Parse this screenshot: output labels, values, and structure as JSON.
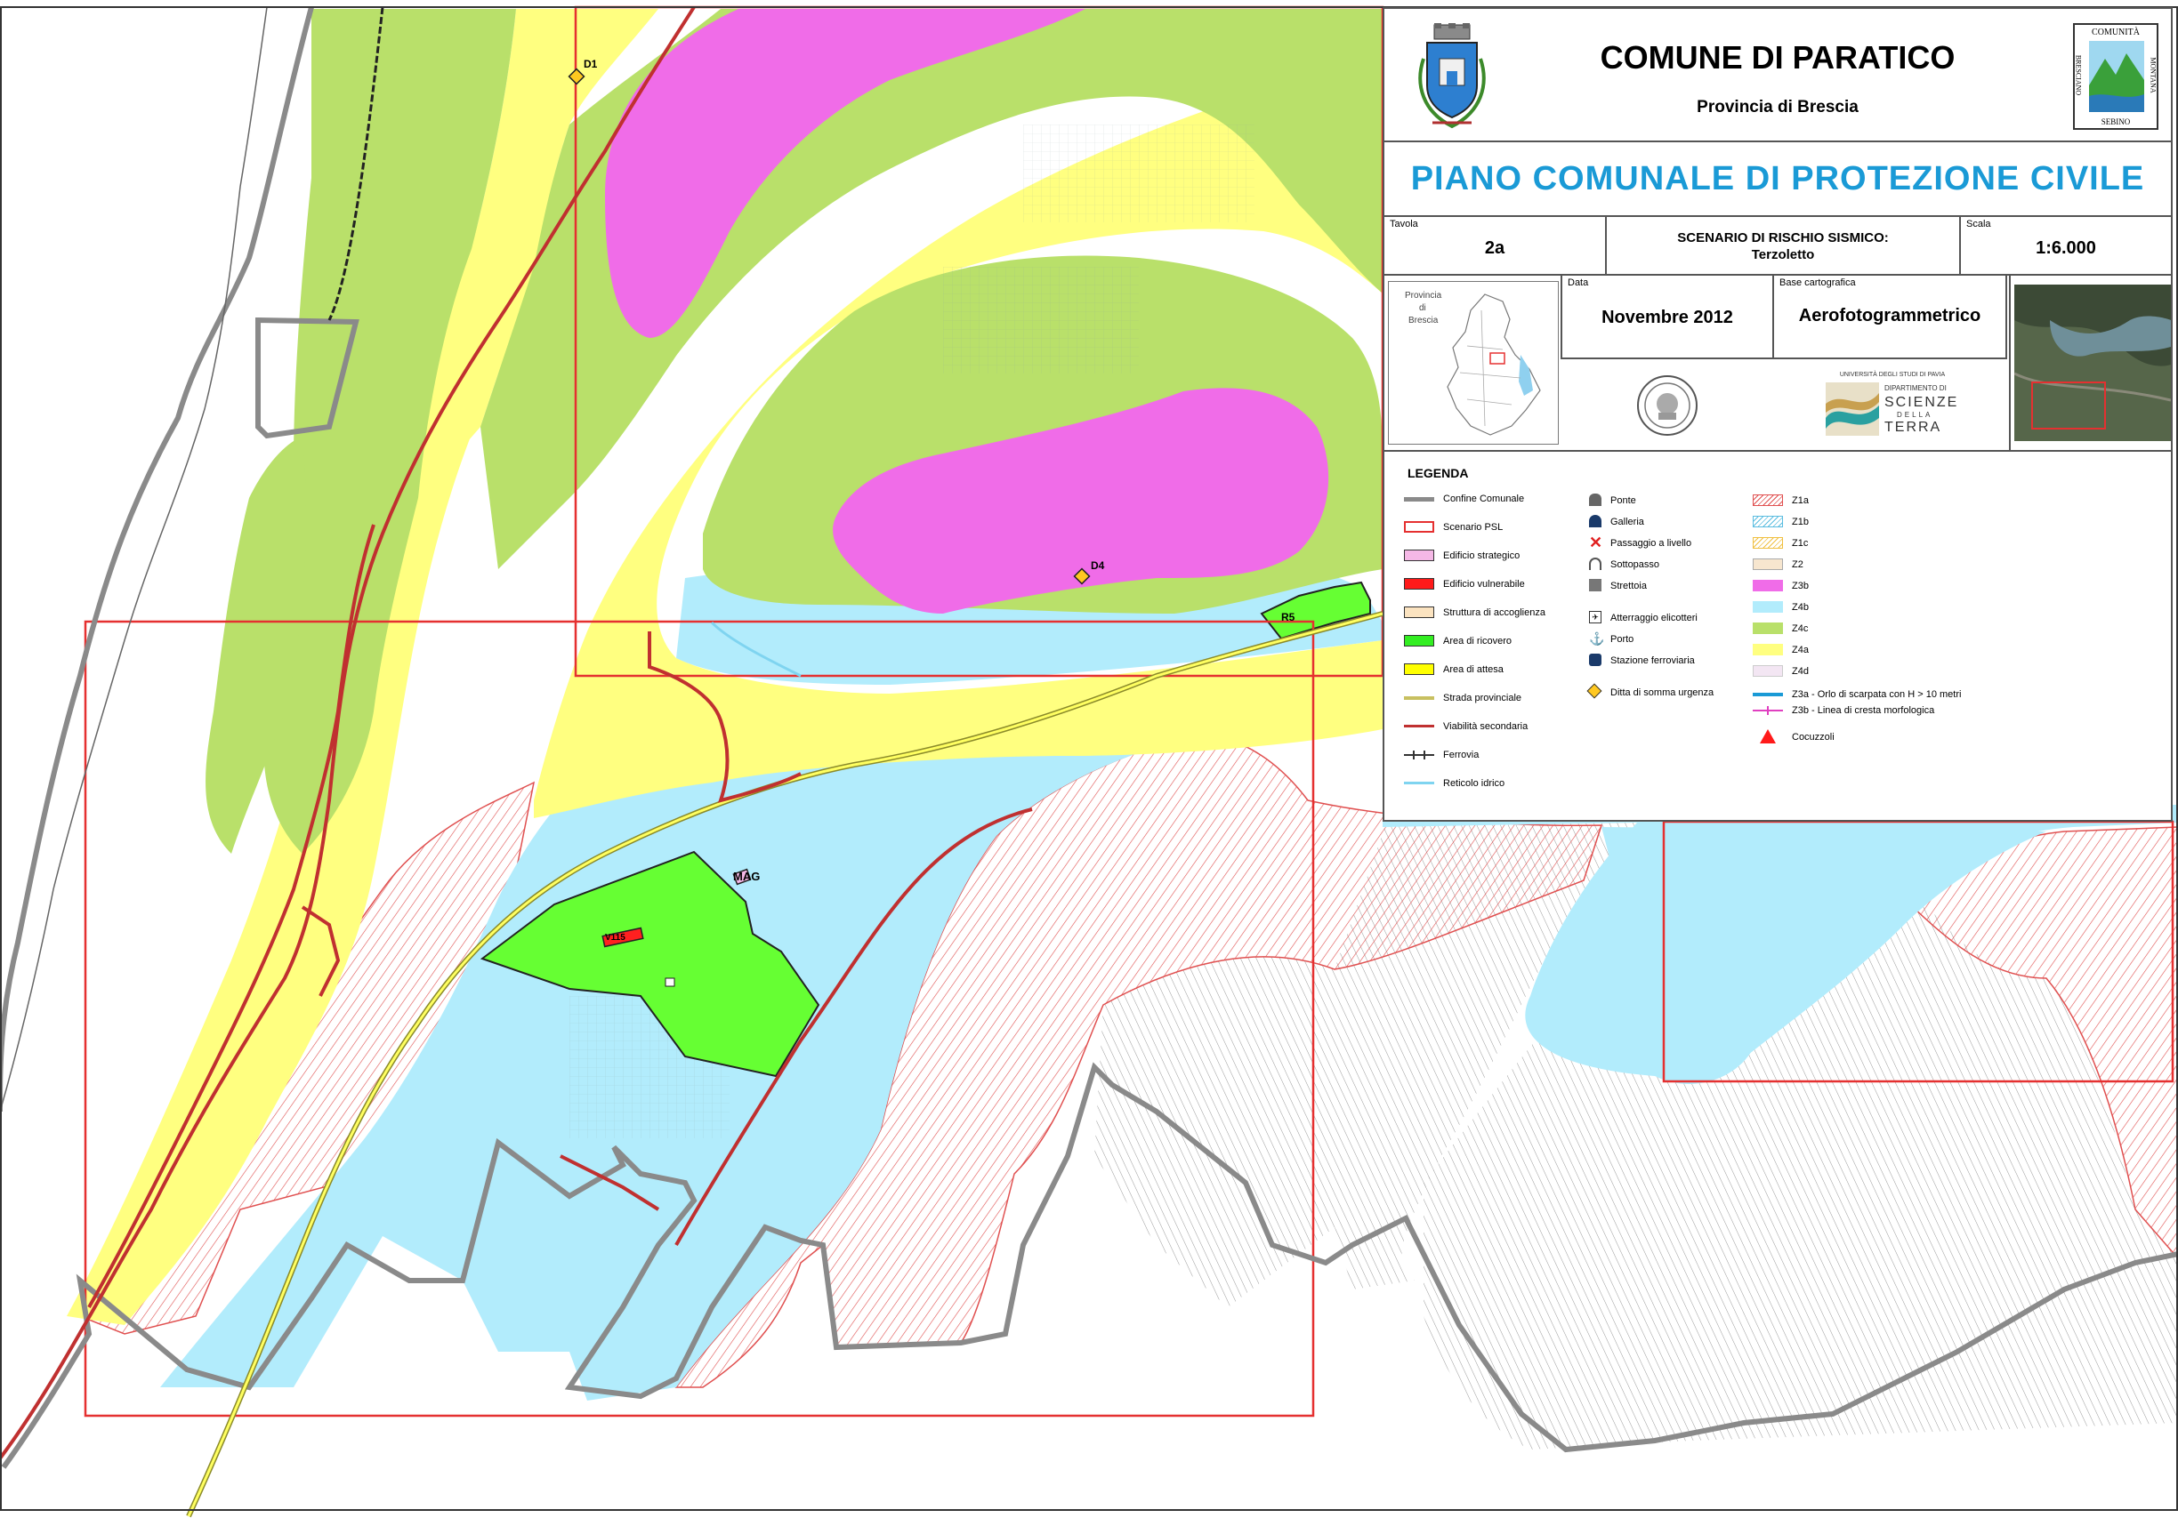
{
  "header": {
    "comune": "COMUNE DI PARATICO",
    "provincia": "Provincia di Brescia",
    "right_logo_top": "COMUNITÀ",
    "right_logo_side_left": "BRESCIANO",
    "right_logo_side_right": "MONTANA",
    "right_logo_bottom": "SEBINO"
  },
  "plan_title": "PIANO COMUNALE DI PROTEZIONE CIVILE",
  "info": {
    "tavola_label": "Tavola",
    "tavola_value": "2a",
    "scenario_line1": "SCENARIO DI RISCHIO SISMICO:",
    "scenario_line2": "Terzoletto",
    "scala_label": "Scala",
    "scala_value": "1:6.000",
    "data_label": "Data",
    "data_value": "Novembre 2012",
    "base_label": "Base cartografica",
    "base_value": "Aerofotogrammetrico",
    "inset_province_label_1": "Provincia",
    "inset_province_label_2": "di",
    "inset_province_label_3": "Brescia",
    "uni_line1": "UNIVERSITÀ DEGLI STUDI DI PAVIA",
    "uni_line2": "DIPARTIMENTO DI",
    "uni_line3": "SCIENZE",
    "uni_line4": "DELLA",
    "uni_line5": "TERRA"
  },
  "legend": {
    "title": "LEGENDA",
    "col1": [
      {
        "label": "Confine Comunale",
        "sym": "line-gray"
      },
      {
        "label": "Scenario PSL",
        "sym": "box-red"
      },
      {
        "label": "Edificio strategico",
        "sym": "fill-pink"
      },
      {
        "label": "Edificio vulnerabile",
        "sym": "fill-red"
      },
      {
        "label": "Struttura di accoglienza",
        "sym": "fill-beige"
      },
      {
        "label": "Area di ricovero",
        "sym": "fill-green"
      },
      {
        "label": "Area di attesa",
        "sym": "fill-yellow"
      },
      {
        "label": "Strada provinciale",
        "sym": "line-olive"
      },
      {
        "label": "Viabilità secondaria",
        "sym": "line-darkred"
      },
      {
        "label": "Ferrovia",
        "sym": "line-rail"
      },
      {
        "label": "Reticolo idrico",
        "sym": "line-lightblue"
      }
    ],
    "col2": [
      {
        "label": "Ponte",
        "icon": "bridge-icon"
      },
      {
        "label": "Galleria",
        "icon": "tunnel-icon"
      },
      {
        "label": "Passaggio a livello",
        "icon": "level-crossing-icon"
      },
      {
        "label": "Sottopasso",
        "icon": "underpass-icon"
      },
      {
        "label": "Strettoia",
        "icon": "narrowing-icon"
      },
      {
        "label": "Atterraggio elicotteri",
        "icon": "helipad-icon"
      },
      {
        "label": "Porto",
        "icon": "port-icon"
      },
      {
        "label": "Stazione ferroviaria",
        "icon": "station-icon"
      },
      {
        "label": "Ditta di somma urgenza",
        "icon": "urgent-company-icon"
      }
    ],
    "col3": [
      {
        "label": "Z1a",
        "sym": "hatch-red"
      },
      {
        "label": "Z1b",
        "sym": "hatch-blue"
      },
      {
        "label": "Z1c",
        "sym": "hatch-orange"
      },
      {
        "label": "Z2",
        "sym": "fill-z2"
      },
      {
        "label": "Z3b",
        "sym": "fill-z3b"
      },
      {
        "label": "Z4b",
        "sym": "fill-z4b"
      },
      {
        "label": "Z4c",
        "sym": "fill-z4c"
      },
      {
        "label": "Z4a",
        "sym": "fill-z4a"
      },
      {
        "label": "Z4d",
        "sym": "fill-z4d"
      },
      {
        "label": "Z3a - Orlo di scarpata con H > 10 metri",
        "sym": "line-z3a"
      },
      {
        "label": "Z3b - Linea di cresta morfologica",
        "sym": "line-z3bline"
      },
      {
        "label": "Cocuzzoli",
        "sym": "triangle-red"
      }
    ]
  },
  "map_labels": {
    "d1": "D1",
    "d4": "D4",
    "r5": "R5",
    "mag": "MAG",
    "vul": "V115"
  },
  "colors": {
    "z4c": "#b9e06a",
    "z4a": "#ffff80",
    "z3b": "#f06ce8",
    "z4b": "#b2ecfc",
    "ricovero": "#66ff33",
    "scenario_red": "#e53030",
    "road_red": "#c03030",
    "boundary_gray": "#8a8a8a",
    "title_blue": "#1a9ad6"
  }
}
